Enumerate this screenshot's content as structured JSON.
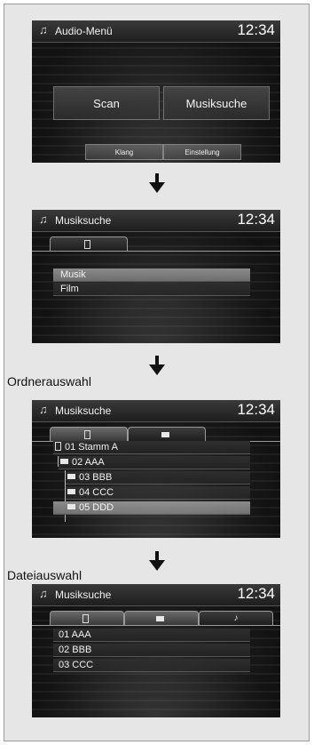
{
  "screen1": {
    "note_icon": "music-note-icon",
    "title": "Audio-Menü",
    "clock": "12:34",
    "scan_label": "Scan",
    "musiksuche_label": "Musiksuche",
    "klang_label": "Klang",
    "einstellung_label": "Einstellung"
  },
  "screen2": {
    "note_icon": "music-note-icon",
    "title": "Musiksuche",
    "clock": "12:34",
    "tabs": [
      {
        "icon": "usb-icon"
      }
    ],
    "items": [
      "Musik",
      "Film"
    ],
    "selected_index": 0
  },
  "label_ordner": "Ordnerauswahl",
  "screen3": {
    "note_icon": "music-note-icon",
    "title": "Musiksuche",
    "clock": "12:34",
    "tabs": [
      {
        "icon": "usb-icon"
      },
      {
        "icon": "folder-icon"
      }
    ],
    "rows": [
      {
        "label": "01 Stamm A",
        "icon": "usb-icon"
      },
      {
        "label": "02 AAA",
        "icon": "folder-icon"
      },
      {
        "label": "03 BBB",
        "icon": "folder-icon"
      },
      {
        "label": "04 CCC",
        "icon": "folder-icon"
      },
      {
        "label": "05 DDD",
        "icon": "folder-icon"
      }
    ],
    "selected_index": 4
  },
  "label_datei": "Dateiauswahl",
  "screen4": {
    "note_icon": "music-note-icon",
    "title": "Musiksuche",
    "clock": "12:34",
    "tabs": [
      {
        "icon": "usb-icon"
      },
      {
        "icon": "folder-icon"
      },
      {
        "icon": "music-note-icon",
        "glyph": "♪"
      }
    ],
    "items": [
      "01 AAA",
      "02 BBB",
      "03 CCC"
    ]
  }
}
